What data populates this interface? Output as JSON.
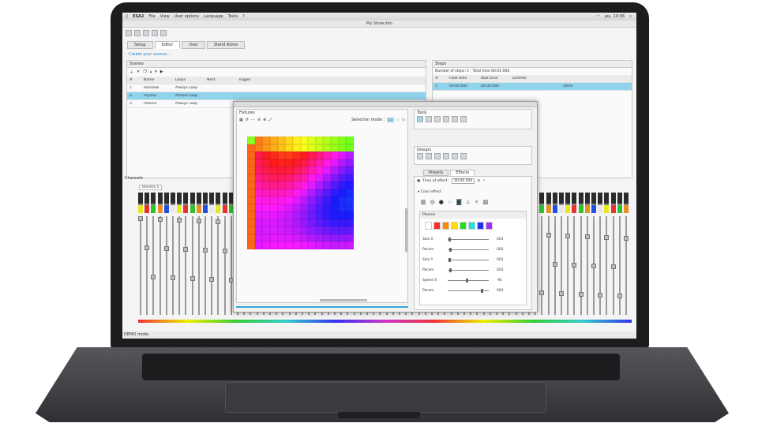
{
  "menubar": {
    "app": "ESA2",
    "items": [
      "File",
      "View",
      "User options",
      "Language",
      "Tools",
      "?"
    ],
    "time": "jeu. 10:56"
  },
  "window": {
    "title": "My Show.dlm"
  },
  "tabs": [
    {
      "label": "Setup"
    },
    {
      "label": "Editor"
    },
    {
      "label": "User"
    },
    {
      "label": "Stand Alone"
    }
  ],
  "create_link": "Create your scenes...",
  "scenes": {
    "title": "Scenes",
    "columns": [
      "#",
      "Name",
      "Loops",
      "Next",
      "Trigger"
    ],
    "rows": [
      {
        "num": "1",
        "name": "Rainbow",
        "loops": "Always Loop"
      },
      {
        "num": "2",
        "name": "Psycho",
        "loops": "Almost Loop"
      },
      {
        "num": "3",
        "name": "Plasma",
        "loops": "Always Loop"
      }
    ]
  },
  "steps": {
    "title": "Steps",
    "info": "Number of steps: 1 - Total time 00:01:000",
    "columns": [
      "#",
      "Fade time",
      "Wait time",
      "Dimmer"
    ],
    "row": {
      "num": "1",
      "fade": "00:00:000",
      "wait": "00:00:000",
      "dimmer": "100%"
    }
  },
  "channels": {
    "title": "Channels",
    "universe": "Univers 1"
  },
  "fixtures": {
    "title": "Fixtures",
    "selection_mode": "Selection mode :"
  },
  "tools": {
    "title": "Tools"
  },
  "groups": {
    "title": "Groups"
  },
  "effects_tabs": [
    {
      "label": "Presets"
    },
    {
      "label": "Effects"
    }
  ],
  "effects": {
    "time_label": "Time of effect :",
    "time_value": "00:00.000",
    "color_effect": "Color effect",
    "plasma": "Plasma"
  },
  "plasma_colors": [
    "#ffffff",
    "#ff2a2a",
    "#ff8c00",
    "#ffe000",
    "#22dd22",
    "#22e0e0",
    "#2233ee",
    "#9b30ff"
  ],
  "params": [
    {
      "label": "Size X",
      "value": "001",
      "pos": 0.02
    },
    {
      "label": "Param",
      "value": "002",
      "pos": 0.04
    },
    {
      "label": "Size Y",
      "value": "001",
      "pos": 0.02
    },
    {
      "label": "Param",
      "value": "002",
      "pos": 0.04
    },
    {
      "label": "Speed X",
      "value": "-91",
      "pos": 0.45
    },
    {
      "label": "Param",
      "value": "002",
      "pos": 0.8
    }
  ],
  "status": "DEMO mode"
}
